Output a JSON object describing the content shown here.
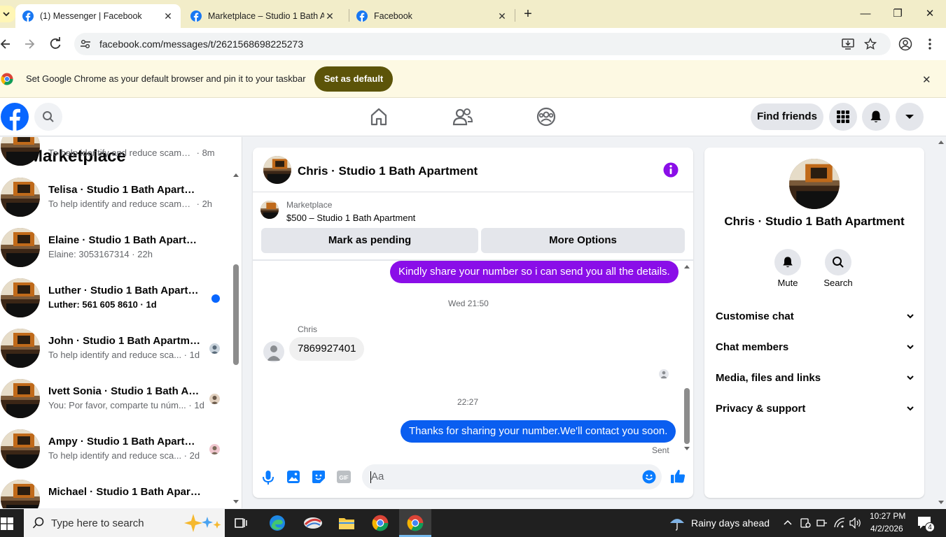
{
  "browser": {
    "tabs": [
      {
        "title": "(1) Messenger | Facebook",
        "active": true
      },
      {
        "title": "Marketplace – Studio 1 Bath Apartment",
        "active": false
      },
      {
        "title": "Facebook",
        "active": false
      }
    ],
    "url": "facebook.com/messages/t/2621568698225273",
    "infobar_message": "Set Google Chrome as your default browser and pin it to your taskbar",
    "infobar_button": "Set as default"
  },
  "fb_header": {
    "find_friends": "Find friends"
  },
  "sidebar": {
    "title": "Marketplace",
    "conversations": [
      {
        "name": "",
        "snippet": "To help identify and reduce scams ...",
        "time": "8m",
        "unread": false
      },
      {
        "name": "Telisa · Studio 1 Bath Apartment",
        "snippet": "To help identify and reduce scams ...",
        "time": "2h",
        "unread": false
      },
      {
        "name": "Elaine · Studio 1 Bath Apartment",
        "snippet": "Elaine: 3053167314",
        "time": "22h",
        "unread": false
      },
      {
        "name": "Luther · Studio 1 Bath Apartme...",
        "snippet": "Luther: 561 605 8610",
        "time": "1d",
        "unread": true
      },
      {
        "name": "John · Studio 1 Bath Apartment",
        "snippet": "To help identify and reduce sca...",
        "time": "1d",
        "unread": false
      },
      {
        "name": "Ivett Sonia · Studio 1 Bath Apa...",
        "snippet": "You: Por favor, comparte tu núm...",
        "time": "1d",
        "unread": false
      },
      {
        "name": "Ampy · Studio 1 Bath Apartme...",
        "snippet": "To help identify and reduce sca...",
        "time": "2d",
        "unread": false
      },
      {
        "name": "Michael · Studio 1 Bath Apartment",
        "snippet": "",
        "time": "",
        "unread": false
      }
    ]
  },
  "chat": {
    "title": "Chris · Studio 1 Bath Apartment",
    "listing_source": "Marketplace",
    "listing": "$500 – Studio 1 Bath Apartment",
    "mark_pending": "Mark as pending",
    "more_options": "More Options",
    "messages": {
      "out1": "Kindly share your number so i can send you all the details.",
      "ts1": "Wed 21:50",
      "sender": "Chris",
      "in1": "7869927401",
      "ts2": "22:27",
      "out2": "Thanks for sharing your number.We'll contact you soon.",
      "status": "Sent"
    },
    "composer_placeholder": "Aa",
    "accent_color": "#8a0ee8"
  },
  "details": {
    "title": "Chris · Studio 1 Bath Apartment",
    "mute": "Mute",
    "search": "Search",
    "sections": [
      "Customise chat",
      "Chat members",
      "Media, files and links",
      "Privacy & support"
    ]
  },
  "taskbar": {
    "search_placeholder": "Type here to search",
    "weather": "Rainy days ahead",
    "time": "10:27 PM",
    "date": "4/2/2026",
    "notifications": "4"
  }
}
